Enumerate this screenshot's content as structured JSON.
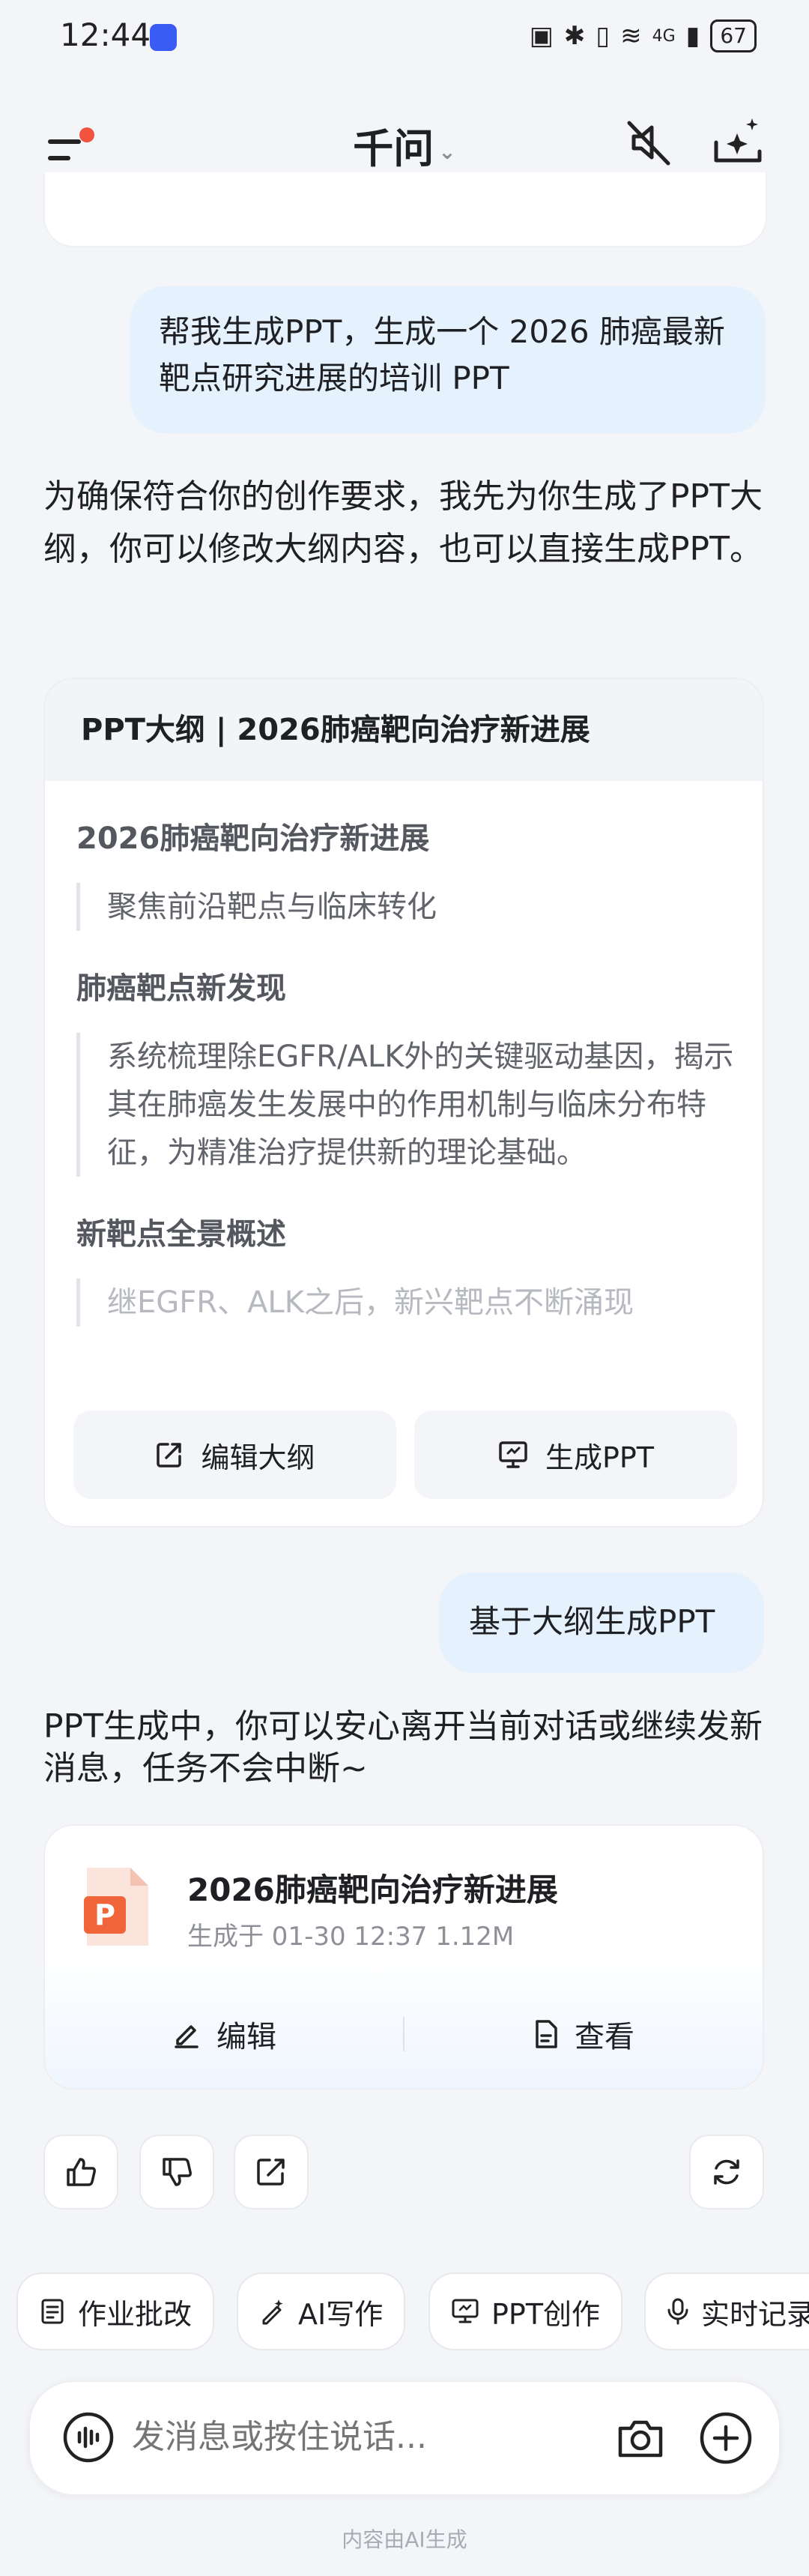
{
  "status_bar": {
    "time": "12:44",
    "network": "4G",
    "battery": "67"
  },
  "header": {
    "title": "千问"
  },
  "messages": {
    "user_prompt": "帮我生成PPT，生成一个 2026 肺癌最新靶点研究进展的培训 PPT",
    "ai_intro": "为确保符合你的创作要求，我先为你生成了PPT大纲，你可以修改大纲内容，也可以直接生成PPT。",
    "user_followup": "基于大纲生成PPT",
    "ai_progress": "PPT生成中，你可以安心离开当前对话或继续发新消息，任务不会中断~"
  },
  "outline": {
    "header": "PPT大纲 | 2026肺癌靶向治疗新进展",
    "sections": [
      {
        "heading": "2026肺癌靶向治疗新进展",
        "text": "聚焦前沿靶点与临床转化"
      },
      {
        "heading": "肺癌靶点新发现",
        "text": "系统梳理除EGFR/ALK外的关键驱动基因，揭示其在肺癌发生发展中的作用机制与临床分布特征，为精准治疗提供新的理论基础。"
      },
      {
        "heading": "新靶点全景概述",
        "text": "继EGFR、ALK之后，新兴靶点不断涌现"
      }
    ],
    "edit_button": "编辑大纲",
    "generate_button": "生成PPT"
  },
  "file_card": {
    "title": "2026肺癌靶向治疗新进展",
    "meta": "生成于 01-30 12:37 1.12M",
    "edit_label": "编辑",
    "view_label": "查看"
  },
  "quick_actions": [
    "作业批改",
    "AI写作",
    "PPT创作",
    "实时记录"
  ],
  "input": {
    "placeholder": "发消息或按住说话..."
  },
  "disclaimer": "内容由AI生成",
  "colors": {
    "accent": "#3b5bf5",
    "user_bubble": "#e5f1fd",
    "ppt_orange": "#f0653a",
    "notification_dot": "#f2533f"
  }
}
